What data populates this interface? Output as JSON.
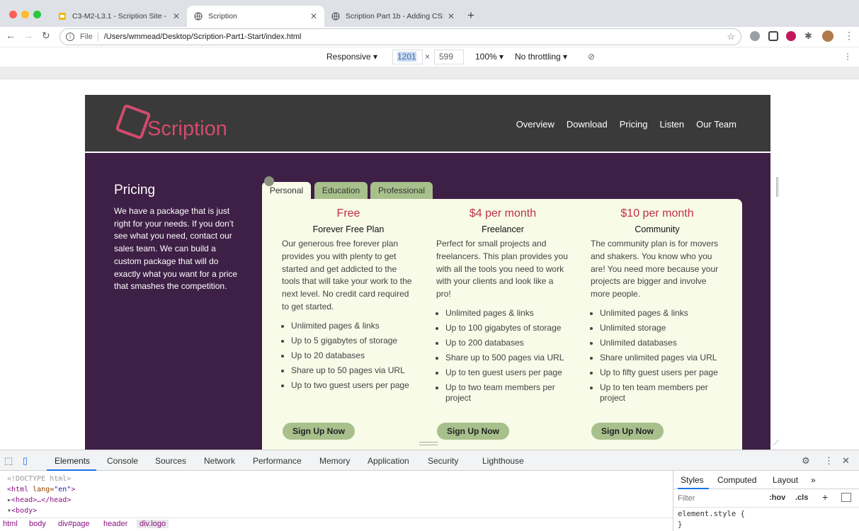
{
  "browser": {
    "tabs": [
      {
        "title": "C3-M2-L3.1 - Scription Site - ",
        "active": false
      },
      {
        "title": "Scription",
        "active": true
      },
      {
        "title": "Scription Part 1b - Adding CSS",
        "active": false
      }
    ],
    "url_scheme_label": "File",
    "url": "/Users/wmmead/Desktop/Scription-Part1-Start/index.html"
  },
  "device_toolbar": {
    "mode": "Responsive",
    "width": "1201",
    "times": "×",
    "height": "599",
    "zoom": "100%",
    "throttling": "No throttling"
  },
  "site": {
    "logo_text": "Scription",
    "nav": [
      "Overview",
      "Download",
      "Pricing",
      "Listen",
      "Our Team"
    ],
    "sidebar": {
      "title": "Pricing",
      "text": "We have a package that is just right for your needs. If you don’t see what you need, contact our sales team. We can build a custom package that will do exactly what you want for a price that smashes the competition."
    },
    "plan_tabs": [
      "Personal",
      "Education",
      "Professional"
    ],
    "plans": [
      {
        "price": "Free",
        "name": "Forever Free Plan",
        "description": "Our generous free forever plan provides you with plenty to get started and get addicted to the tools that will take your work to the next level. No credit card required to get started.",
        "features": [
          "Unlimited pages & links",
          "Up to 5 gigabytes of storage",
          "Up to 20 databases",
          "Share up to 50 pages via URL",
          "Up to two guest users per page"
        ],
        "cta": "Sign Up Now"
      },
      {
        "price": "$4 per month",
        "name": "Freelancer",
        "description": "Perfect for small projects and freelancers. This plan provides you with all the tools you need to work with your clients and look like a pro!",
        "features": [
          "Unlimited pages & links",
          "Up to 100 gigabytes of storage",
          "Up to 200 databases",
          "Share up to 500 pages via URL",
          "Up to ten guest users per page",
          "Up to two team members per project"
        ],
        "cta": "Sign Up Now"
      },
      {
        "price": "$10 per month",
        "name": "Community",
        "description": "The community plan is for movers and shakers. You know who you are! You need more because your projects are bigger and involve more people.",
        "features": [
          "Unlimited pages & links",
          "Unlimited storage",
          "Unlimited databases",
          "Share unlimited pages via URL",
          "Up to fifty guest users per page",
          "Up to ten team members per project"
        ],
        "cta": "Sign Up Now"
      }
    ]
  },
  "devtools": {
    "tabs": [
      "Elements",
      "Console",
      "Sources",
      "Network",
      "Performance",
      "Memory",
      "Application",
      "Security",
      "Lighthouse"
    ],
    "dom": {
      "doctype": "<!DOCTYPE html>",
      "html_open": "<html",
      "lang_attr": " lang=",
      "lang_val": "\"en\"",
      "html_close": ">",
      "head": "<head>…</head>",
      "body": "<body>"
    },
    "breadcrumbs": [
      "html",
      "body",
      "div#page",
      "header",
      "div.logo"
    ],
    "styles_tabs": [
      "Styles",
      "Computed",
      "Layout",
      "»"
    ],
    "filter_placeholder": "Filter",
    "hov": ":hov",
    "cls": ".cls",
    "plus": "+",
    "rule_open": "element.style {",
    "rule_close": "}"
  },
  "colors": {
    "header_bg": "#3a3a3a",
    "main_bg": "#3e1f46",
    "panel_bg": "#f7fbe8",
    "price_color": "#c03048",
    "tab_inactive": "#a8c08c",
    "logo": "#d44a6f"
  }
}
